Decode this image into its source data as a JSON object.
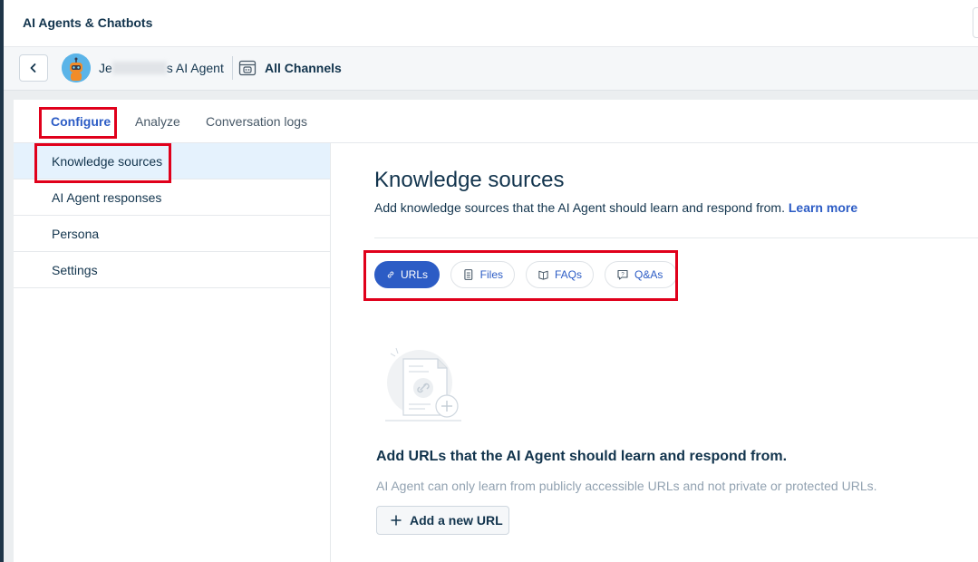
{
  "app": {
    "title": "AI Agents & Chatbots"
  },
  "agent_bar": {
    "agent_name_prefix": "Je",
    "agent_name_suffix": "s AI Agent",
    "channels_label": "All Channels"
  },
  "tabs": [
    {
      "label": "Configure",
      "active": true
    },
    {
      "label": "Analyze",
      "active": false
    },
    {
      "label": "Conversation logs",
      "active": false
    }
  ],
  "sidebar": {
    "items": [
      {
        "label": "Knowledge sources",
        "active": true
      },
      {
        "label": "AI Agent responses",
        "active": false
      },
      {
        "label": "Persona",
        "active": false
      },
      {
        "label": "Settings",
        "active": false
      }
    ]
  },
  "main": {
    "heading": "Knowledge sources",
    "subtext": "Add knowledge sources that the AI Agent should learn and respond from.",
    "learn_more": "Learn more",
    "source_types": [
      {
        "label": "URLs",
        "icon": "link-icon",
        "active": true
      },
      {
        "label": "Files",
        "icon": "file-icon",
        "active": false
      },
      {
        "label": "FAQs",
        "icon": "book-icon",
        "active": false
      },
      {
        "label": "Q&As",
        "icon": "chat-question-icon",
        "active": false
      }
    ],
    "empty_state": {
      "title": "Add URLs that the AI Agent should learn and respond from.",
      "description": "AI Agent can only learn from publicly accessible URLs and not private or protected URLs.",
      "button_label": "Add a new URL"
    }
  },
  "colors": {
    "accent": "#2c5cc5",
    "highlight": "#e0001b",
    "text": "#12344d",
    "active_row": "#e5f2fd"
  }
}
